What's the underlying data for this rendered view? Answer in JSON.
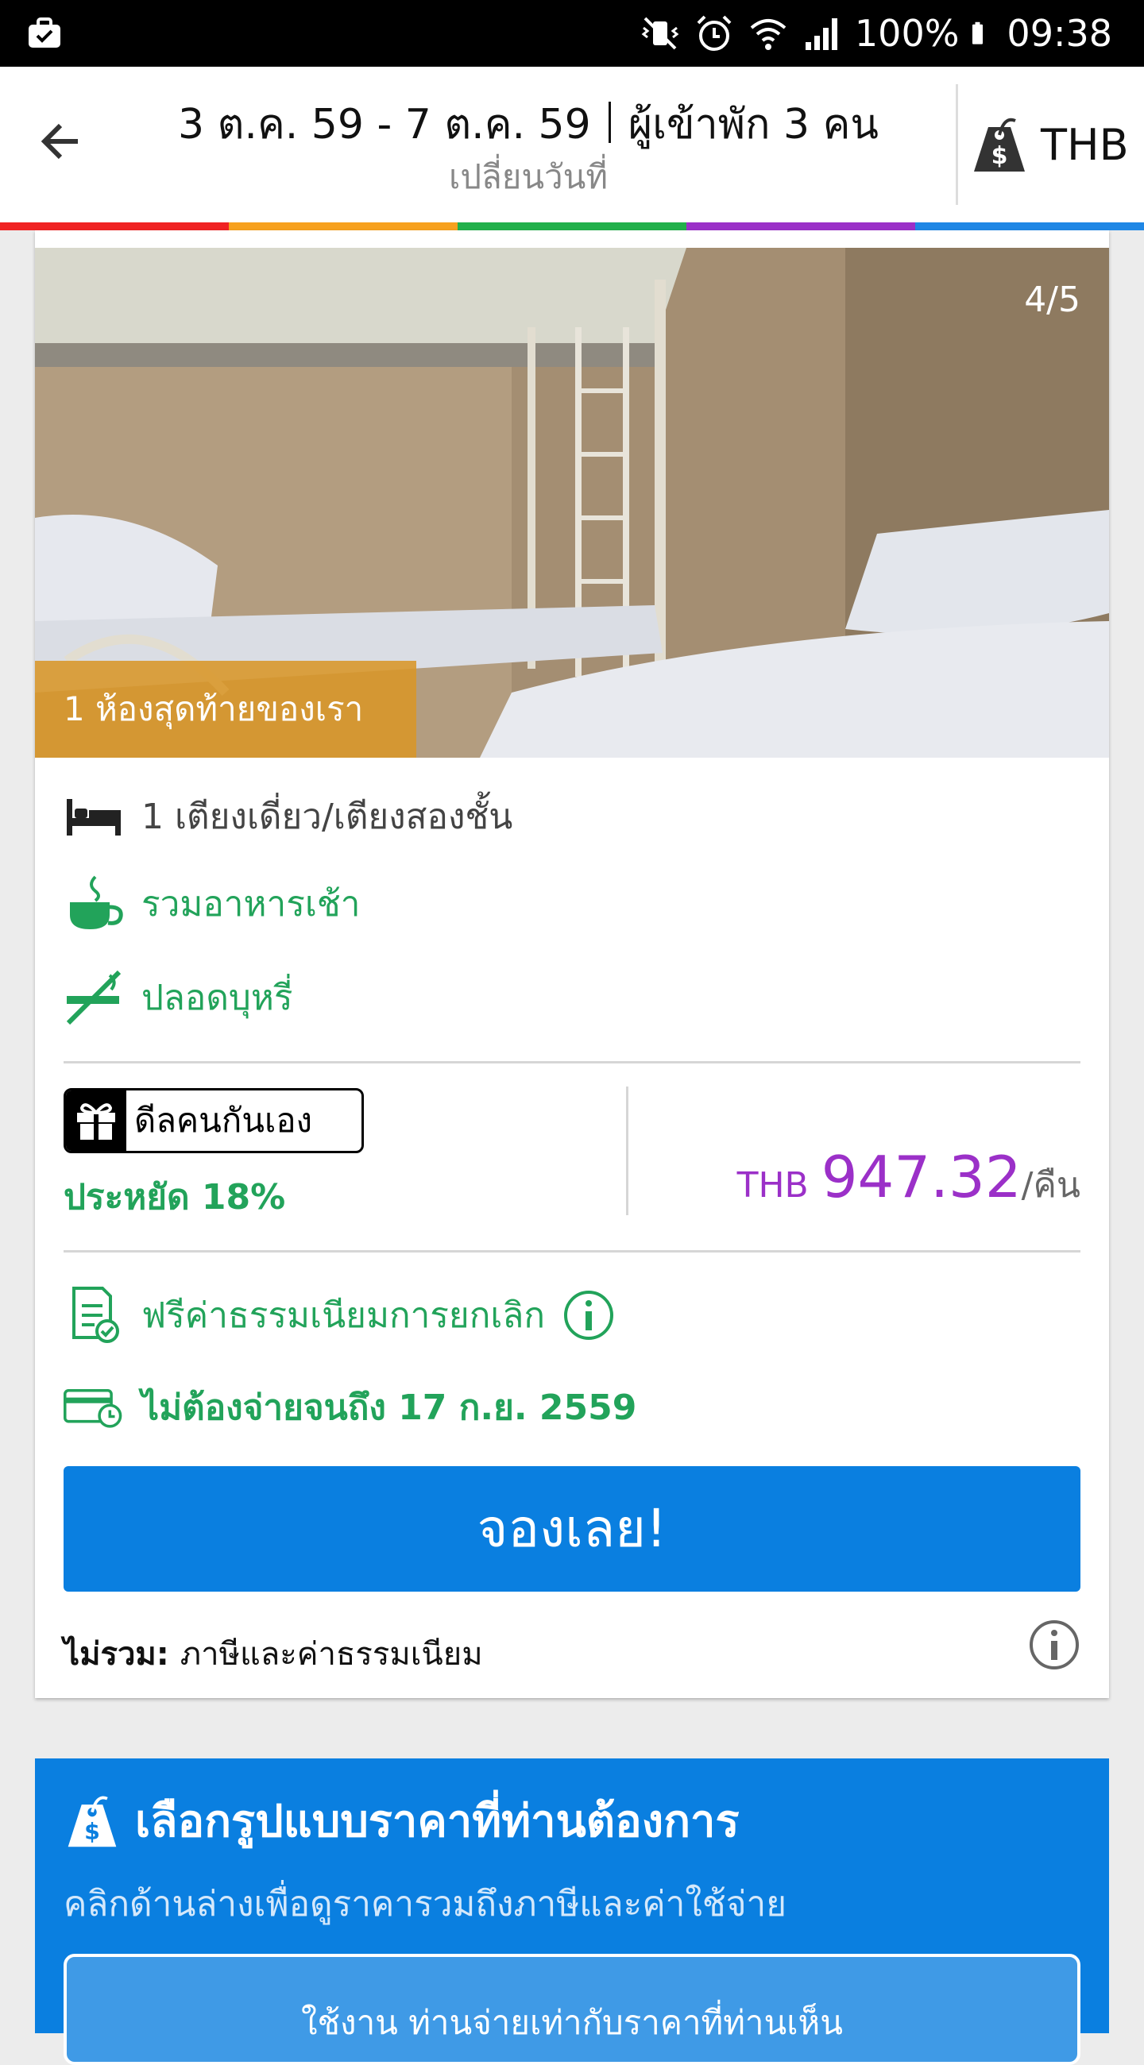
{
  "status_bar": {
    "battery": "100%",
    "time": "09:38"
  },
  "header": {
    "dates": "3 ต.ค. 59 - 7 ต.ค. 59",
    "guests": "ผู้เข้าพัก 3 คน",
    "change_date": "เปลี่ยนวันที่",
    "currency": "THB"
  },
  "colors": {
    "red": "#f02323",
    "orange": "#f7a11e",
    "green": "#22b04b",
    "purple": "#9b30c8",
    "blue": "#1f87e5",
    "accent": "#22a35a",
    "primary": "#0a7fe0"
  },
  "photo": {
    "counter": "4/5",
    "last_room": "1 ห้องสุดท้ายของเรา"
  },
  "features": [
    {
      "icon": "bed-icon",
      "label": "1 เตียงเดี่ยว/เตียงสองชั้น"
    },
    {
      "icon": "coffee-cup-icon",
      "label": "รวมอาหารเช้า"
    },
    {
      "icon": "no-smoking-icon",
      "label": "ปลอดบุหรี่"
    }
  ],
  "deal": {
    "badge": "ดีลคนกันเอง",
    "savings": "ประหยัด 18%"
  },
  "price": {
    "currency": "THB",
    "value": "947.32",
    "per_night": "/คืน"
  },
  "cancellation": {
    "label": "ฟรีค่าธรรมเนียมการยกเลิก"
  },
  "payment": {
    "label": "ไม่ต้องจ่ายจนถึง 17 ก.ย. 2559"
  },
  "book_button": "จองเลย!",
  "excluded": {
    "label": "ไม่รวม:",
    "value": "ภาษีและค่าธรรมเนียม"
  },
  "price_display": {
    "title": "เลือกรูปแบบราคาที่ท่านต้องการ",
    "subtitle": "คลิกด้านล่างเพื่อดูราคารวมถึงภาษีและค่าใช้จ่าย",
    "option": "ใช้งาน ท่านจ่ายเท่ากับราคาที่ท่านเห็น"
  }
}
